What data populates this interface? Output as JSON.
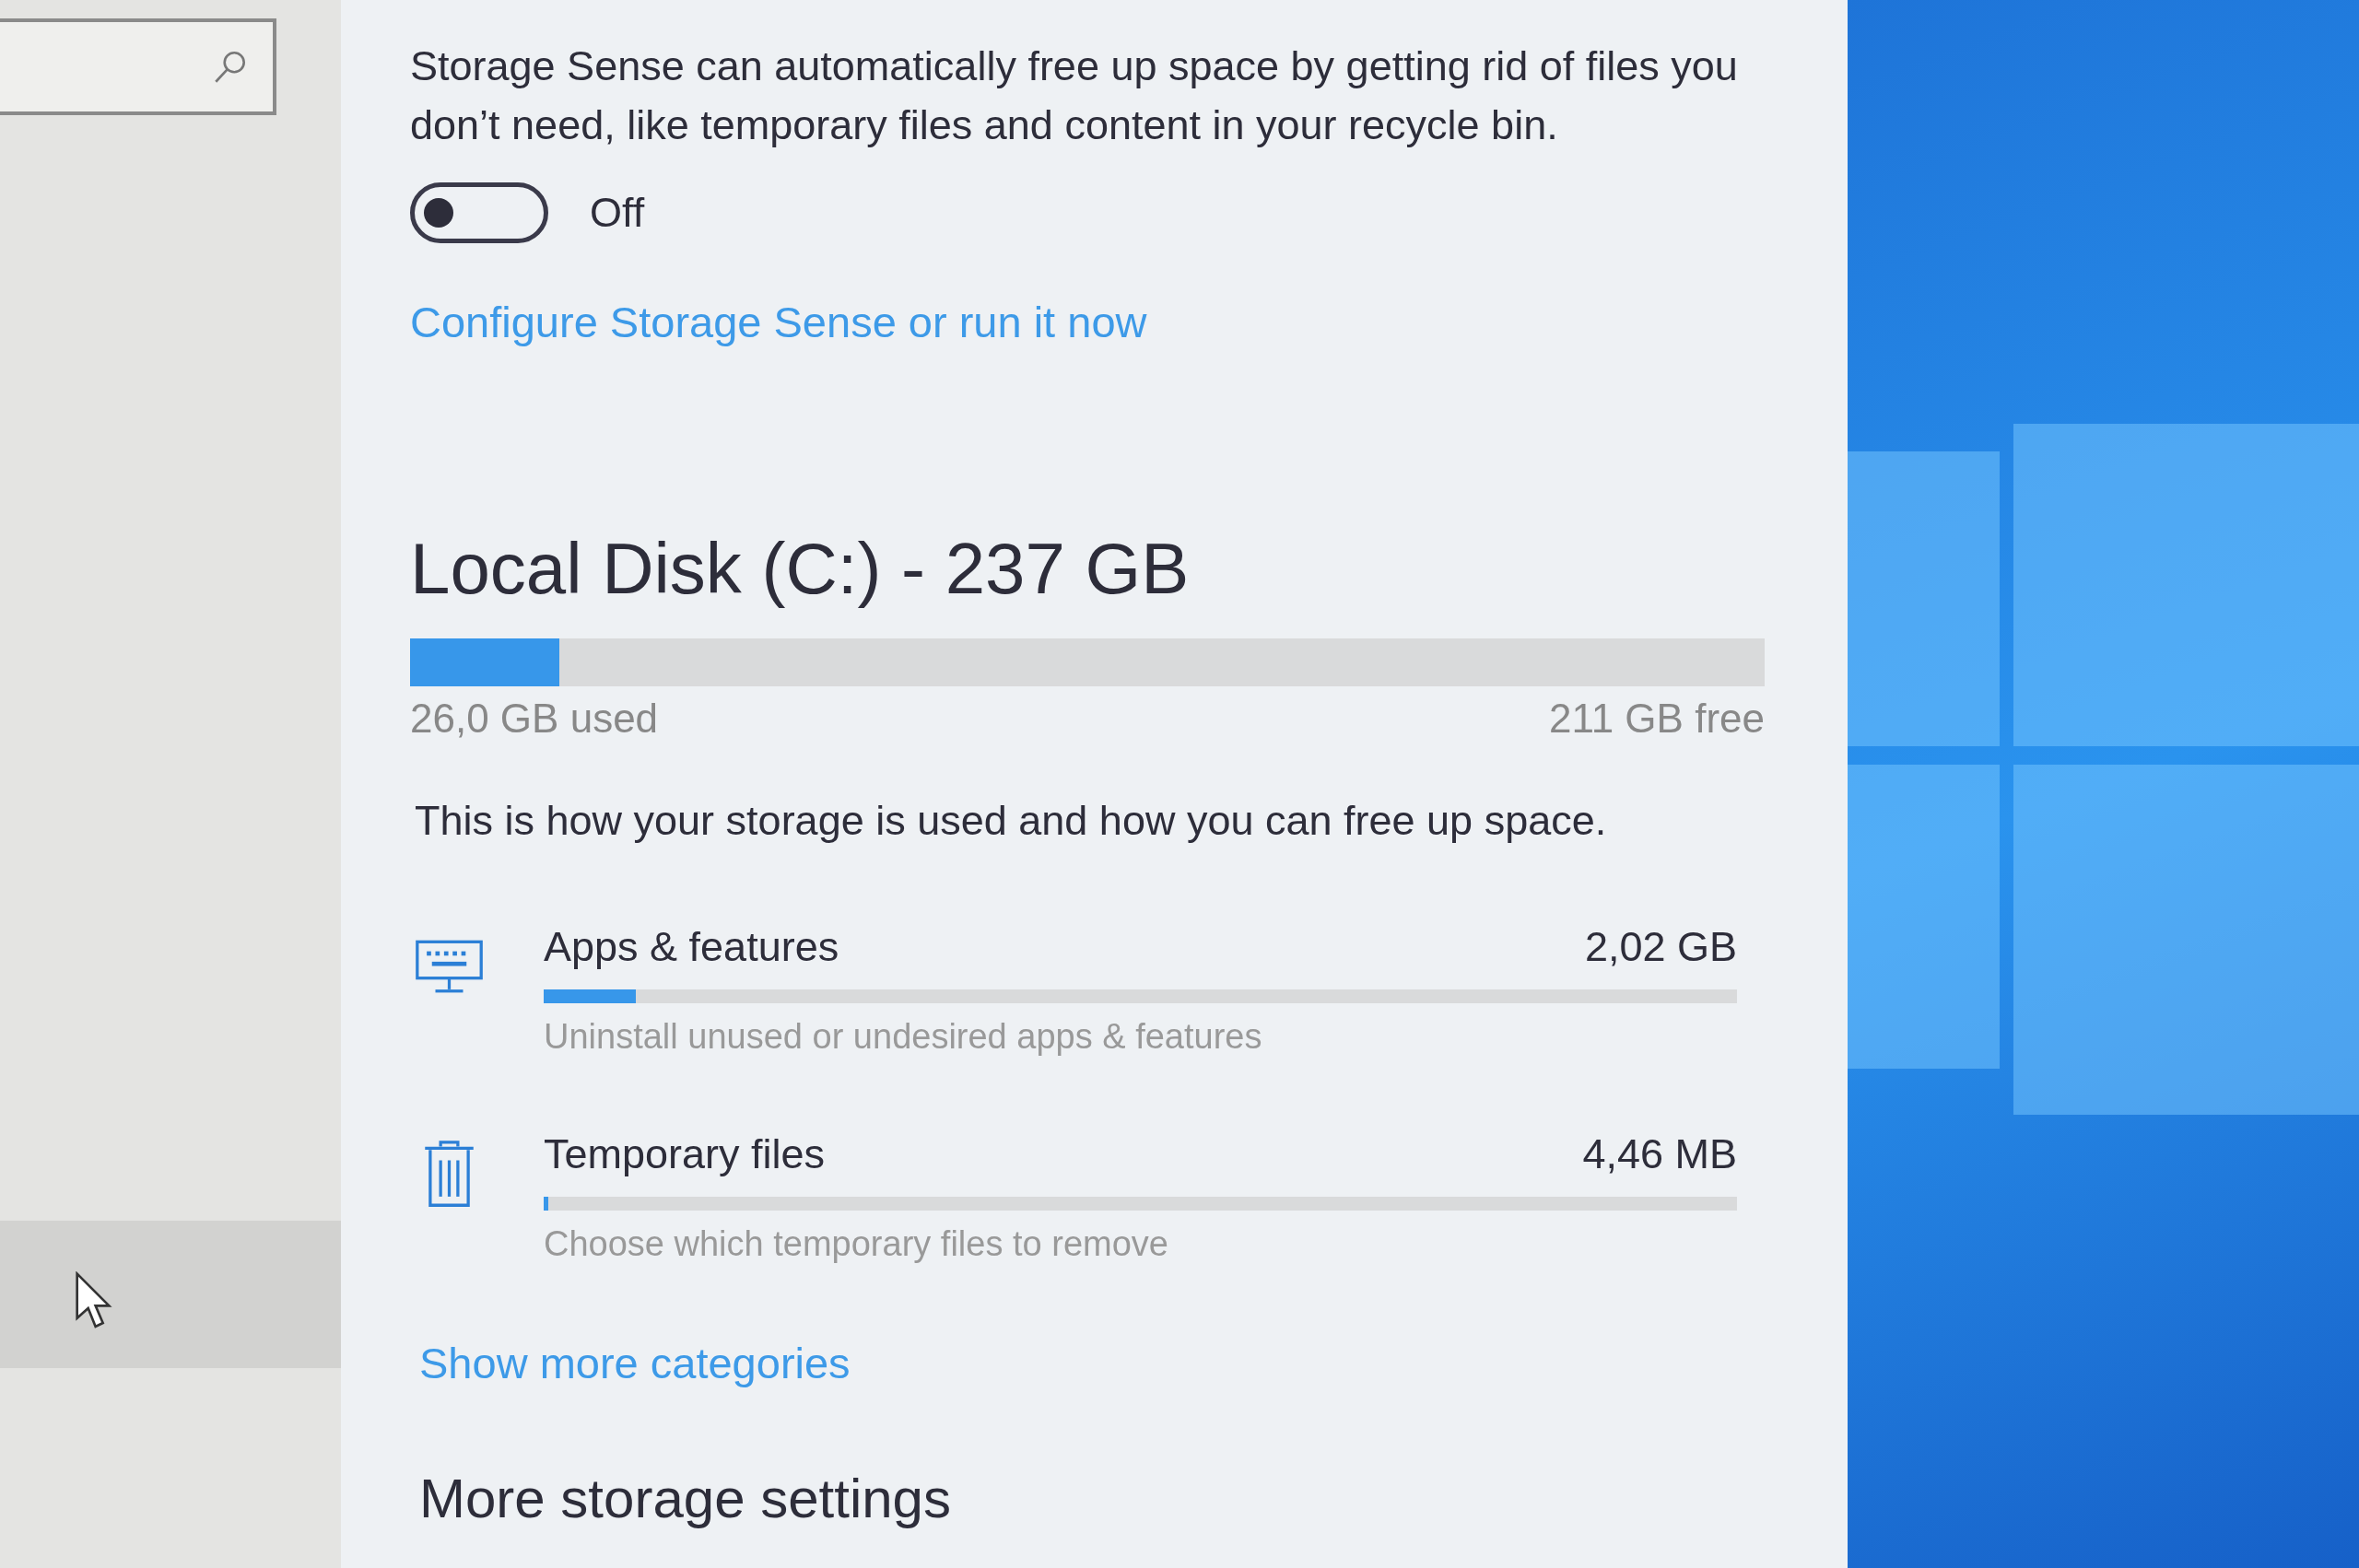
{
  "storage_sense": {
    "description": "Storage Sense can automatically free up space by getting rid of files you don’t need, like temporary files and content in your recycle bin.",
    "toggle": {
      "on": false,
      "label": "Off"
    },
    "link": "Configure Storage Sense or run it now"
  },
  "disk": {
    "title": "Local Disk (C:) - 237 GB",
    "level": 0.11,
    "used": "26,0 GB used",
    "free": "211 GB free"
  },
  "description": "This is how your storage is used and how you can free up space.",
  "categories": [
    {
      "kind": "apps",
      "name": "Apps & features",
      "size": "2,02 GB",
      "level": 0.077,
      "hint": "Uninstall unused or undesired apps & features"
    },
    {
      "kind": "temp",
      "name": "Temporary files",
      "size": "4,46 MB",
      "level": 0.004,
      "hint": "Choose which temporary files to remove"
    }
  ],
  "show_more": "Show more categories",
  "section_heading": "More storage settings"
}
